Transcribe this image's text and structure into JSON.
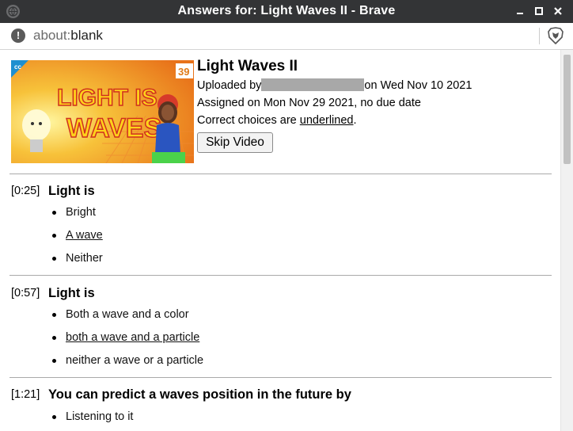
{
  "window": {
    "title": "Answers for: Light Waves II - Brave"
  },
  "address": {
    "scheme": "about:",
    "path": "blank"
  },
  "video": {
    "title": "Light Waves II",
    "uploaded_prefix": "Uploaded by",
    "uploaded_suffix": "on Wed Nov 10 2021",
    "assigned": "Assigned on Mon Nov 29 2021, no due date",
    "correct_prefix": "Correct choices are ",
    "correct_word": "underlined",
    "correct_suffix": ".",
    "skip_label": "Skip Video",
    "thumbnail": {
      "episode": "39",
      "line1": "LIGHT IS",
      "line2": "WAVES",
      "badge": "cc"
    }
  },
  "questions": [
    {
      "time": "[0:25]",
      "text": "Light is",
      "choices": [
        {
          "text": "Bright",
          "correct": false
        },
        {
          "text": "A wave",
          "correct": true
        },
        {
          "text": "Neither",
          "correct": false
        }
      ]
    },
    {
      "time": "[0:57]",
      "text": "Light is",
      "choices": [
        {
          "text": "Both a wave and a color",
          "correct": false
        },
        {
          "text": "both a wave and a particle",
          "correct": true
        },
        {
          "text": "neither a wave or a particle",
          "correct": false
        }
      ]
    },
    {
      "time": "[1:21]",
      "text": "You can predict a waves position in the future by",
      "choices": [
        {
          "text": "Listening to it",
          "correct": false
        }
      ]
    }
  ]
}
